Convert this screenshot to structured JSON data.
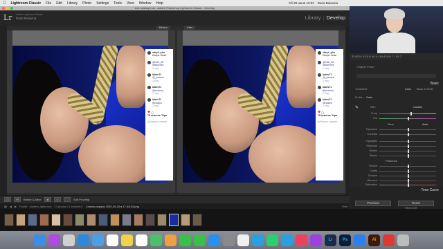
{
  "menubar": {
    "app_name": "Lightroom Classic",
    "items": [
      "File",
      "Edit",
      "Library",
      "Photo",
      "Settings",
      "Tools",
      "View",
      "Window",
      "Help"
    ],
    "clock": "Сб 20 июня 15:32",
    "user": "Daria Bulavina"
  },
  "window": {
    "title": "test catalog.lrcat - Adobe Photoshop Lightroom Classic - Develop"
  },
  "identity": {
    "logo": "Lr",
    "catalog_label": "Adobe Lightroom Classic",
    "user_name": "Daria Bulavina",
    "modules": [
      "Library",
      "Develop"
    ],
    "separator": "|",
    "active_module": "Develop"
  },
  "compare": {
    "before_label": "Before",
    "after_label": "After"
  },
  "insta_overlay": {
    "entries": [
      {
        "user": "xttryh_pho",
        "text": "Искра. Нежн"
      },
      {
        "user": "@man_35",
        "text": "@sanchez"
      },
      {
        "user": "lubov71",
        "text": "@_yanaza"
      },
      {
        "user": "lubov71",
        "text": "@mommy"
      },
      {
        "user": "lubov71",
        "text": "@nastyu"
      }
    ],
    "time_label": "1 нед.",
    "likes": "78 отметок \"Нра",
    "add_comment": "Добавьте коммен"
  },
  "toolbar": {
    "view_mode": "Before & After:",
    "soft_proofing": "Soft Proofing"
  },
  "filmstrip": {
    "path": "Folder : student_lightroom",
    "count": "13 photos / 1 selected /",
    "filename": "Снимок экрана 2020-05-20 в 17.48.53.png",
    "filter": "Filter :",
    "filters_off": "Filters Off",
    "thumb_count": 17
  },
  "right_panel": {
    "histogram_readout": "R 42.9 / 42.9   G 40.4 / 40.4   B 51.7 / 51.7",
    "original_photo": "Original Photo",
    "basic_title": "Basic",
    "treatment_label": "Treatment :",
    "treatment_color": "Color",
    "treatment_bw": "Black & White",
    "profile_label": "Profile :",
    "profile_value": "Color",
    "wb_label": "WB :",
    "wb_value": "Custom",
    "tone_label": "Tone",
    "auto_label": "Auto",
    "presence_label": "Presence",
    "sliders_wb": [
      "Temp",
      "Tint"
    ],
    "sliders_tone": [
      "Exposure",
      "Contrast",
      "Highlights",
      "Shadows",
      "Whites",
      "Blacks"
    ],
    "sliders_presence": [
      "Texture",
      "Clarity",
      "Dehaze",
      "Vibrance",
      "Saturation"
    ],
    "tone_curve_title": "Tone Curve",
    "previous_button": "Previous",
    "reset_button": "Reset"
  },
  "dock": {
    "icons": [
      "Finder",
      "Siri",
      "Launchpad",
      "Safari",
      "Mail",
      "Calendar",
      "Notes",
      "Reminders",
      "Maps",
      "Photos",
      "Messages",
      "FaceTime",
      "App Store",
      "System Preferences",
      "Chrome",
      "Skype",
      "WhatsApp",
      "Telegram",
      "Music",
      "Podcasts",
      "Lr",
      "Ps",
      "Zoom",
      "Ai",
      "Creative Cloud",
      "Trash"
    ]
  },
  "colors": {
    "accent": "#e2e2e2",
    "panel_bg": "#262626",
    "photo_blue": "#1a2c9c"
  }
}
